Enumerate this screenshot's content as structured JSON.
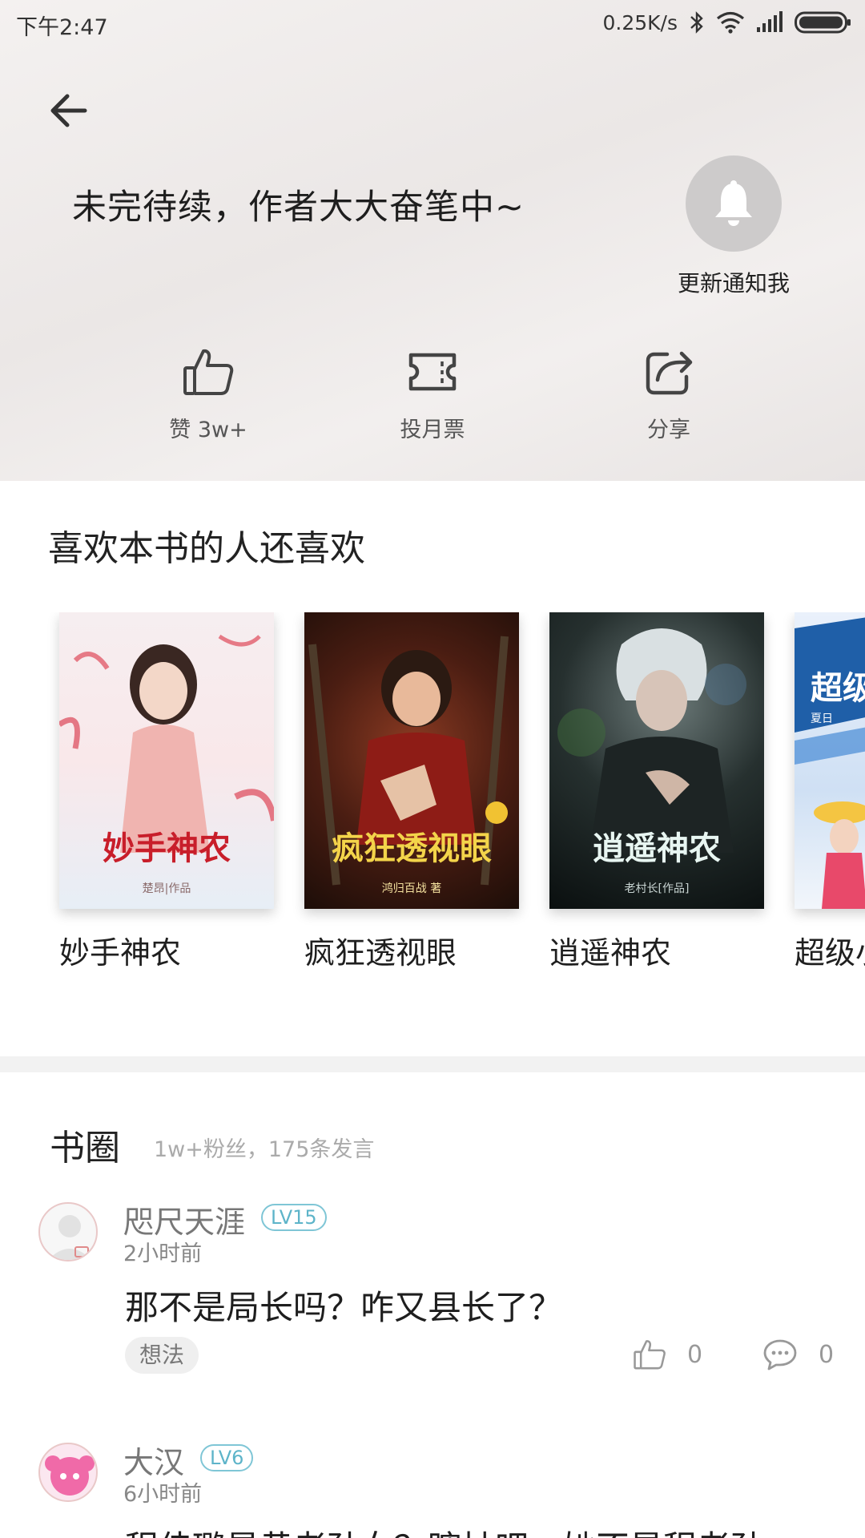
{
  "status_bar": {
    "time": "下午2:47",
    "net_speed": "0.25K/s"
  },
  "header": {
    "serial_status": "未完待续，作者大大奋笔中~",
    "notify_label": "更新通知我"
  },
  "actions": {
    "like_label": "赞 3w+",
    "ticket_label": "投月票",
    "share_label": "分享"
  },
  "recommend": {
    "title": "喜欢本书的人还喜欢",
    "books": [
      {
        "name": "妙手神农",
        "cover_title": "妙手神农",
        "cover_author": "楚昂|作品"
      },
      {
        "name": "疯狂透视眼",
        "cover_title": "疯狂透视眼",
        "cover_author": "鸿归百战 著"
      },
      {
        "name": "逍遥神农",
        "cover_title": "逍遥神农",
        "cover_author": "老村长[作品]"
      },
      {
        "name": "超级小",
        "cover_title": "超级小",
        "cover_author": "夏日"
      }
    ]
  },
  "circle": {
    "title": "书圈",
    "stats": "1w+粉丝，175条发言",
    "posts": [
      {
        "user": "咫尺天涯",
        "level": "LV15",
        "time": "2小时前",
        "text": "那不是局长吗？咋又县长了？",
        "tag": "想法",
        "likes": "0",
        "comments": "0"
      },
      {
        "user": "大汉",
        "level": "LV6",
        "time": "6小时前",
        "text": "程佳璐是黄老孙女？瞎扯吧，她不是程老孙"
      }
    ]
  },
  "colors": {
    "level_badge": "#5db4c9",
    "notify_bg": "#cdcbcb"
  }
}
